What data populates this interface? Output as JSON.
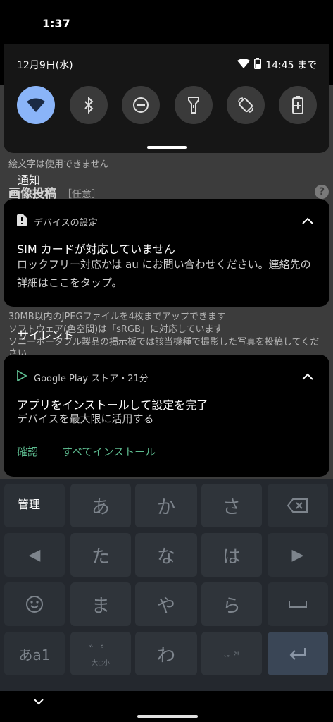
{
  "status_bar": {
    "time": "1:37"
  },
  "background_page": {
    "line_emoji": "絵文字は使用できません",
    "heading": "画像投稿",
    "heading_optional": "［任意］",
    "help_icon": "?",
    "line_1": "30MB以内のJPEGファイルを4枚までアップできます",
    "line_2": "ソフトウェア(色空間)は「sRGB」に対応しています",
    "line_3": "ソニーポータブル製品の掲示板では該当機種で撮影した写真を投稿してくだ",
    "line_4": "さい"
  },
  "keyboard": {
    "rows": [
      [
        "あ",
        "か",
        "さ"
      ],
      [
        "た",
        "な",
        "は"
      ],
      [
        "ま",
        "や",
        "ら"
      ]
    ],
    "bottom_left": "あa1",
    "bottom_wa": "わ",
    "bottom_dakuten": "゛゜",
    "bottom_dakuten_sub": "大◌小",
    "bottom_punct_sub": "、。?!",
    "left_arrow": "◀",
    "right_arrow": "▶",
    "emoji_icon": "smiley-icon",
    "backspace_icon": "backspace-icon",
    "space_icon": "space-icon",
    "enter_icon": "enter-icon"
  },
  "quick_settings": {
    "date": "12月9日(水)",
    "battery_text": "14:45 まで",
    "tiles": [
      {
        "icon": "wifi-icon",
        "active": true
      },
      {
        "icon": "bluetooth-icon",
        "active": false
      },
      {
        "icon": "do-not-disturb-icon",
        "active": false
      },
      {
        "icon": "flashlight-icon",
        "active": false
      },
      {
        "icon": "auto-rotate-icon",
        "active": false
      },
      {
        "icon": "battery-saver-icon",
        "active": false
      }
    ]
  },
  "sections": {
    "notifications": "通知",
    "silent": "サイレント",
    "manage": "管理"
  },
  "notification_device": {
    "app": "デバイスの設定",
    "title": "SIM カードが対応していません",
    "text": "ロックフリー対応かは au にお問い合わせください。連絡先の詳細はここをタップ。"
  },
  "notification_play": {
    "app": "Google Play ストア・21分",
    "title": "アプリをインストールして設定を完了",
    "text": "デバイスを最大限に活用する",
    "action_confirm": "確認",
    "action_install_all": "すべてインストール"
  },
  "colors": {
    "accent_tile": "#8ab4f8",
    "action_text": "#5dbb8f"
  }
}
